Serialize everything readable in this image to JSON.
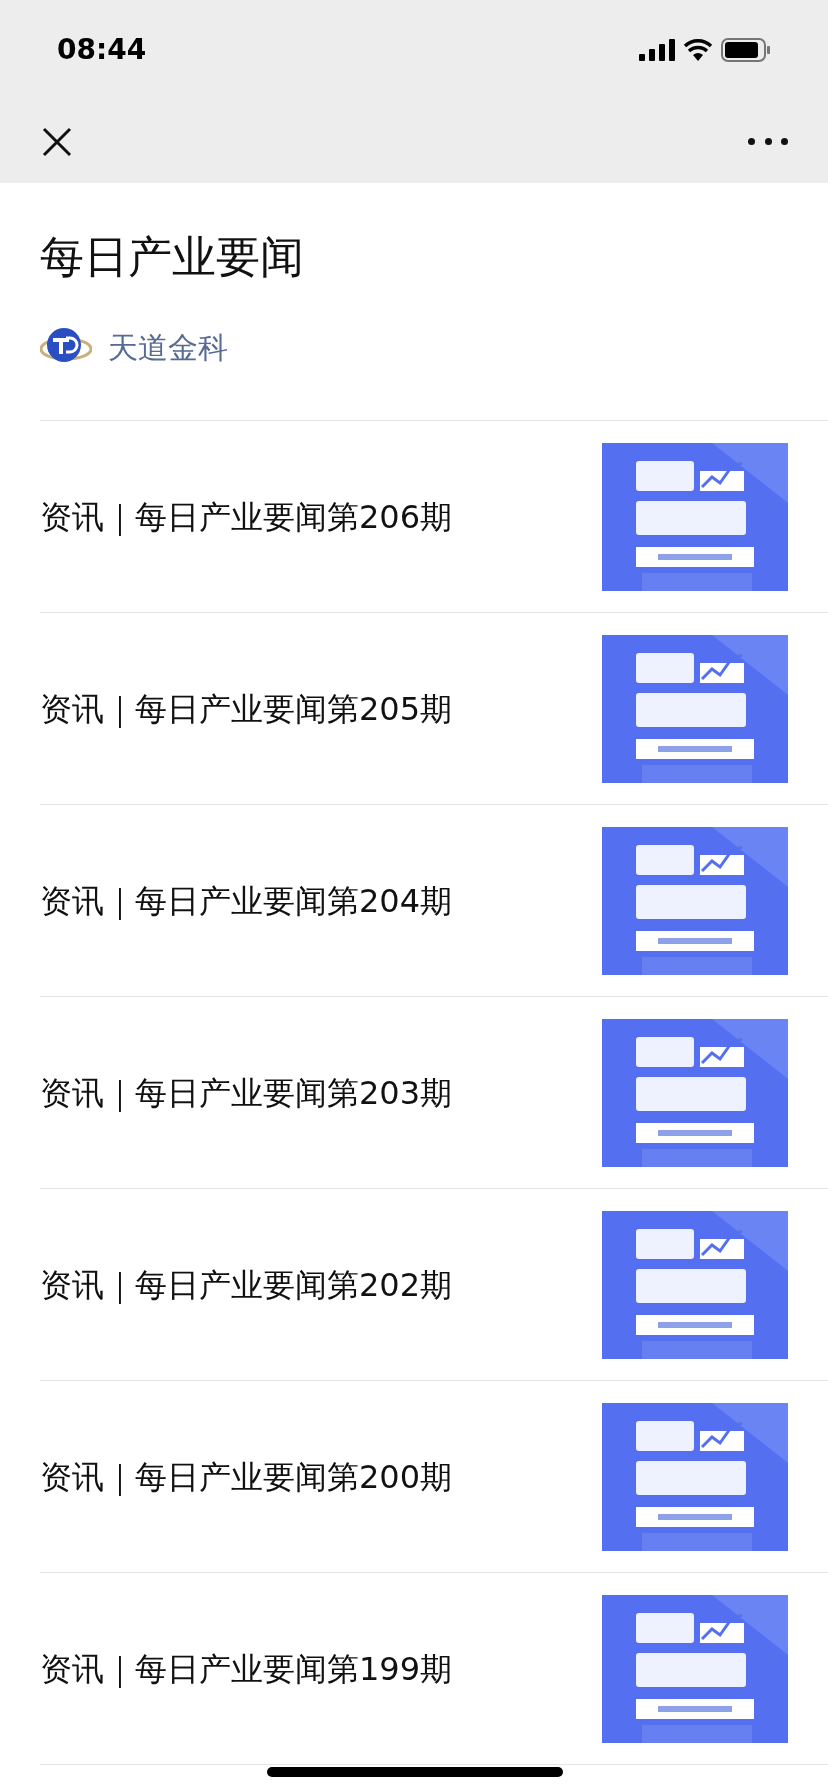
{
  "status_bar": {
    "time": "08:44"
  },
  "header": {
    "title": "每日产业要闻",
    "account": "天道金科"
  },
  "articles": [
    {
      "title": "资讯｜每日产业要闻第206期"
    },
    {
      "title": "资讯｜每日产业要闻第205期"
    },
    {
      "title": "资讯｜每日产业要闻第204期"
    },
    {
      "title": "资讯｜每日产业要闻第203期"
    },
    {
      "title": "资讯｜每日产业要闻第202期"
    },
    {
      "title": "资讯｜每日产业要闻第200期"
    },
    {
      "title": "资讯｜每日产业要闻第199期"
    }
  ]
}
